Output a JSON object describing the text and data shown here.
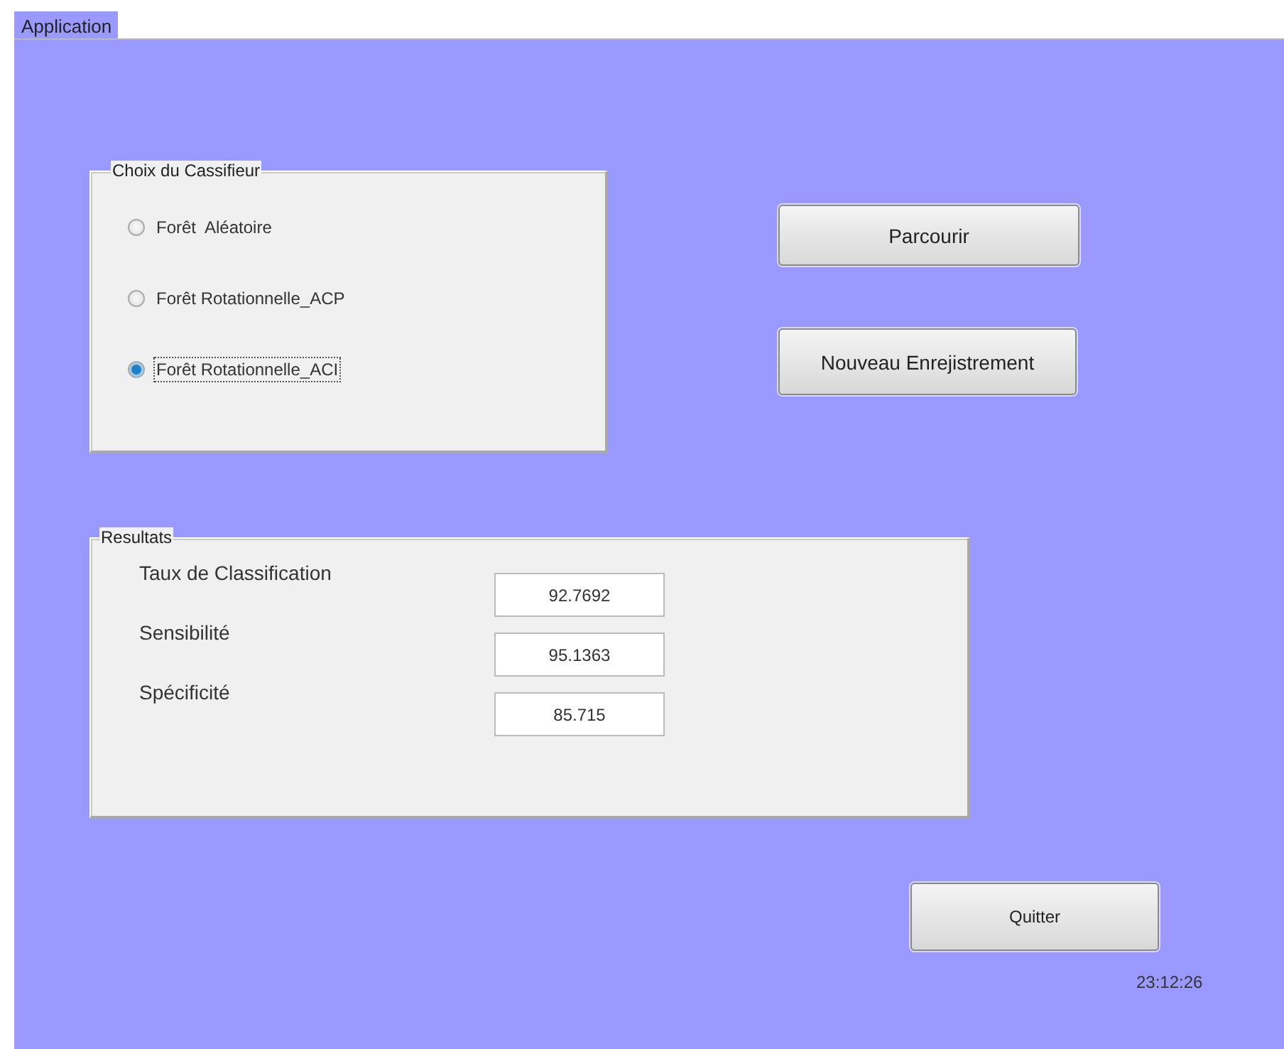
{
  "window": {
    "title": "Application"
  },
  "classifier_group": {
    "title": "Choix du Cassifieur",
    "options": [
      {
        "label": "Forêt  Aléatoire",
        "selected": false
      },
      {
        "label": "Forêt Rotationnelle_ACP",
        "selected": false
      },
      {
        "label": "Forêt Rotationnelle_ACI",
        "selected": true
      }
    ]
  },
  "buttons": [
    "Parcourir",
    "Nouveau Enrejistrement"
  ],
  "results_group": {
    "title": "Resultats",
    "rows": [
      {
        "label": "Taux de Classification",
        "value": "92.7692"
      },
      {
        "label": "Sensibilité",
        "value": "95.1363"
      },
      {
        "label": "Spécificité",
        "value": "85.715"
      }
    ]
  },
  "quit_button": "Quitter",
  "clock": "23:12:26"
}
